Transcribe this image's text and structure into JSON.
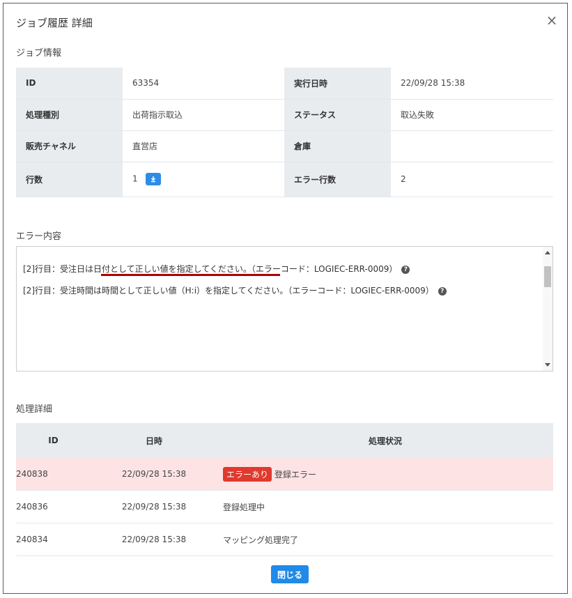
{
  "modal": {
    "title": "ジョブ履歴 詳細",
    "close_glyph": "×"
  },
  "job_info": {
    "section_title": "ジョブ情報",
    "rows": [
      {
        "l1": "ID",
        "v1": "63354",
        "l2": "実行日時",
        "v2": "22/09/28 15:38"
      },
      {
        "l1": "処理種別",
        "v1": "出荷指示取込",
        "l2": "ステータス",
        "v2": "取込失敗"
      },
      {
        "l1": "販売チャネル",
        "v1": "直営店",
        "l2": "倉庫",
        "v2": ""
      },
      {
        "l1": "行数",
        "v1": "1",
        "l2": "エラー行数",
        "v2": "2"
      }
    ],
    "download_icon": "download-icon"
  },
  "errors": {
    "section_title": "エラー内容",
    "lines": [
      "[2]行目：受注日は日付として正しい値を指定してください。（エラーコード：LOGIEC-ERR-0009）",
      "[2]行目：受注時間は時間として正しい値（H:i）を指定してください。（エラーコード：LOGIEC-ERR-0009）"
    ],
    "help_glyph": "?",
    "highlight_color": "#b00000"
  },
  "details": {
    "section_title": "処理詳細",
    "headers": [
      "ID",
      "日時",
      "処理状況"
    ],
    "rows": [
      {
        "id": "240838",
        "datetime": "22/09/28 15:38",
        "badge": "エラーあり",
        "status": "登録エラー"
      },
      {
        "id": "240836",
        "datetime": "22/09/28 15:38",
        "badge": "",
        "status": "登録処理中"
      },
      {
        "id": "240834",
        "datetime": "22/09/28 15:38",
        "badge": "",
        "status": "マッピング処理完了"
      }
    ],
    "error_row_bg": "#fde3e4",
    "badge_color": "#e0392e"
  },
  "footer": {
    "close_label": "閉じる",
    "accent": "#1f8ae8"
  }
}
